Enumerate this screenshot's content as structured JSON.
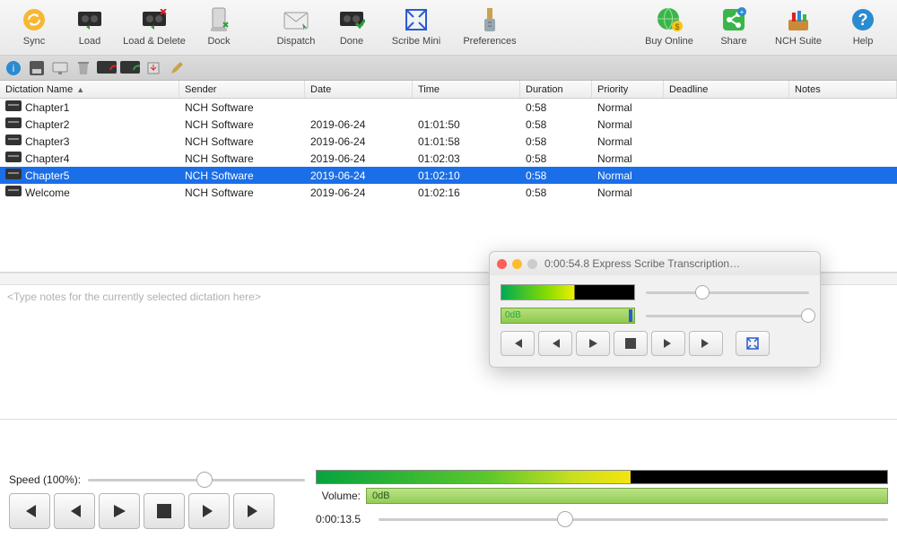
{
  "toolbar": {
    "sync": "Sync",
    "load": "Load",
    "load_delete": "Load & Delete",
    "dock": "Dock",
    "dispatch": "Dispatch",
    "done": "Done",
    "scribe_mini": "Scribe Mini",
    "preferences": "Preferences",
    "buy_online": "Buy Online",
    "share": "Share",
    "nch_suite": "NCH Suite",
    "help": "Help"
  },
  "columns": {
    "name": "Dictation Name",
    "sender": "Sender",
    "date": "Date",
    "time": "Time",
    "duration": "Duration",
    "priority": "Priority",
    "deadline": "Deadline",
    "notes": "Notes"
  },
  "rows": [
    {
      "name": "Chapter1",
      "sender": "NCH Software",
      "date": "",
      "time": "",
      "duration": "0:58",
      "priority": "Normal",
      "deadline": "",
      "notes": "",
      "selected": false
    },
    {
      "name": "Chapter2",
      "sender": "NCH Software",
      "date": "2019-06-24",
      "time": "01:01:50",
      "duration": "0:58",
      "priority": "Normal",
      "deadline": "",
      "notes": "",
      "selected": false
    },
    {
      "name": "Chapter3",
      "sender": "NCH Software",
      "date": "2019-06-24",
      "time": "01:01:58",
      "duration": "0:58",
      "priority": "Normal",
      "deadline": "",
      "notes": "",
      "selected": false
    },
    {
      "name": "Chapter4",
      "sender": "NCH Software",
      "date": "2019-06-24",
      "time": "01:02:03",
      "duration": "0:58",
      "priority": "Normal",
      "deadline": "",
      "notes": "",
      "selected": false
    },
    {
      "name": "Chapter5",
      "sender": "NCH Software",
      "date": "2019-06-24",
      "time": "01:02:10",
      "duration": "0:58",
      "priority": "Normal",
      "deadline": "",
      "notes": "",
      "selected": true
    },
    {
      "name": "Welcome",
      "sender": "NCH Software",
      "date": "2019-06-24",
      "time": "01:02:16",
      "duration": "0:58",
      "priority": "Normal",
      "deadline": "",
      "notes": "",
      "selected": false
    }
  ],
  "notes_placeholder": "<Type notes for the currently selected dictation here>",
  "mini": {
    "title": "0:00:54.8 Express Scribe Transcription…",
    "db_label": "0dB",
    "progress_pct": 30,
    "volume_pct": 95
  },
  "bottom": {
    "speed_label": "Speed (100%):",
    "speed_pct": 50,
    "volume_label": "Volume:",
    "db_label": "0dB",
    "time_label": "0:00:13.5",
    "time_pos_pct": 35
  }
}
